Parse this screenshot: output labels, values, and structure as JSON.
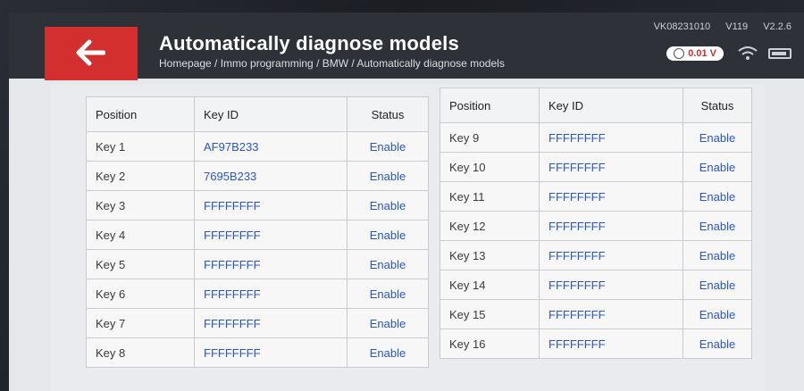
{
  "status_bar": {
    "serial": "VK08231010",
    "version": "V119",
    "app_version": "V2.2.6",
    "voltage": "0.01 V"
  },
  "header": {
    "title": "Automatically diagnose models",
    "breadcrumb": "Homepage / Immo programming / BMW / Automatically diagnose models"
  },
  "table_left": {
    "headers": {
      "position": "Position",
      "key_id": "Key ID",
      "status": "Status"
    },
    "rows": [
      {
        "position": "Key 1",
        "key_id": "AF97B233",
        "status": "Enable"
      },
      {
        "position": "Key 2",
        "key_id": "7695B233",
        "status": "Enable"
      },
      {
        "position": "Key 3",
        "key_id": "FFFFFFFF",
        "status": "Enable"
      },
      {
        "position": "Key 4",
        "key_id": "FFFFFFFF",
        "status": "Enable"
      },
      {
        "position": "Key 5",
        "key_id": "FFFFFFFF",
        "status": "Enable"
      },
      {
        "position": "Key 6",
        "key_id": "FFFFFFFF",
        "status": "Enable"
      },
      {
        "position": "Key 7",
        "key_id": "FFFFFFFF",
        "status": "Enable"
      },
      {
        "position": "Key 8",
        "key_id": "FFFFFFFF",
        "status": "Enable"
      }
    ]
  },
  "table_right": {
    "headers": {
      "position": "Position",
      "key_id": "Key ID",
      "status": "Status"
    },
    "rows": [
      {
        "position": "Key 9",
        "key_id": "FFFFFFFF",
        "status": "Enable"
      },
      {
        "position": "Key 10",
        "key_id": "FFFFFFFF",
        "status": "Enable"
      },
      {
        "position": "Key 11",
        "key_id": "FFFFFFFF",
        "status": "Enable"
      },
      {
        "position": "Key 12",
        "key_id": "FFFFFFFF",
        "status": "Enable"
      },
      {
        "position": "Key 13",
        "key_id": "FFFFFFFF",
        "status": "Enable"
      },
      {
        "position": "Key 14",
        "key_id": "FFFFFFFF",
        "status": "Enable"
      },
      {
        "position": "Key 15",
        "key_id": "FFFFFFFF",
        "status": "Enable"
      },
      {
        "position": "Key 16",
        "key_id": "FFFFFFFF",
        "status": "Enable"
      }
    ]
  },
  "colors": {
    "back_button": "#d32f2f",
    "header_bg": "#2f3138",
    "link_blue": "#2a56c6"
  },
  "icons": {
    "back": "arrow-left-icon",
    "wifi": "wifi-icon",
    "battery": "battery-icon",
    "voltage": "voltage-icon"
  }
}
